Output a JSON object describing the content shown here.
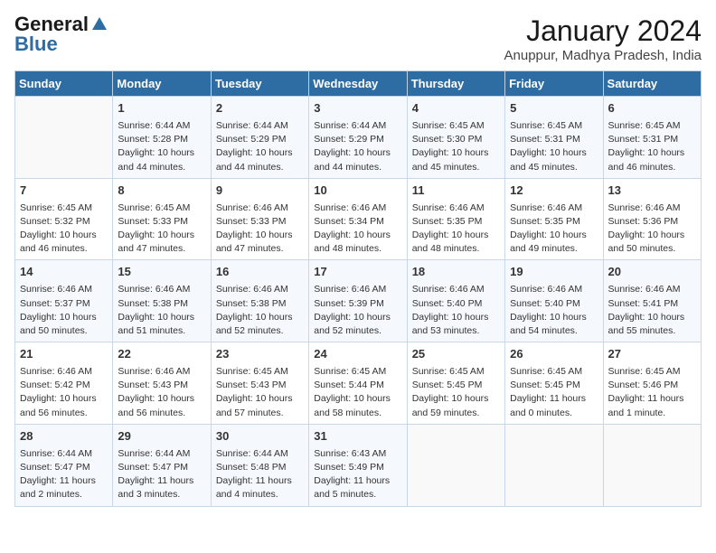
{
  "header": {
    "logo_general": "General",
    "logo_blue": "Blue",
    "month": "January 2024",
    "location": "Anuppur, Madhya Pradesh, India"
  },
  "days_of_week": [
    "Sunday",
    "Monday",
    "Tuesday",
    "Wednesday",
    "Thursday",
    "Friday",
    "Saturday"
  ],
  "weeks": [
    [
      {
        "day": "",
        "info": ""
      },
      {
        "day": "1",
        "info": "Sunrise: 6:44 AM\nSunset: 5:28 PM\nDaylight: 10 hours\nand 44 minutes."
      },
      {
        "day": "2",
        "info": "Sunrise: 6:44 AM\nSunset: 5:29 PM\nDaylight: 10 hours\nand 44 minutes."
      },
      {
        "day": "3",
        "info": "Sunrise: 6:44 AM\nSunset: 5:29 PM\nDaylight: 10 hours\nand 44 minutes."
      },
      {
        "day": "4",
        "info": "Sunrise: 6:45 AM\nSunset: 5:30 PM\nDaylight: 10 hours\nand 45 minutes."
      },
      {
        "day": "5",
        "info": "Sunrise: 6:45 AM\nSunset: 5:31 PM\nDaylight: 10 hours\nand 45 minutes."
      },
      {
        "day": "6",
        "info": "Sunrise: 6:45 AM\nSunset: 5:31 PM\nDaylight: 10 hours\nand 46 minutes."
      }
    ],
    [
      {
        "day": "7",
        "info": "Sunrise: 6:45 AM\nSunset: 5:32 PM\nDaylight: 10 hours\nand 46 minutes."
      },
      {
        "day": "8",
        "info": "Sunrise: 6:45 AM\nSunset: 5:33 PM\nDaylight: 10 hours\nand 47 minutes."
      },
      {
        "day": "9",
        "info": "Sunrise: 6:46 AM\nSunset: 5:33 PM\nDaylight: 10 hours\nand 47 minutes."
      },
      {
        "day": "10",
        "info": "Sunrise: 6:46 AM\nSunset: 5:34 PM\nDaylight: 10 hours\nand 48 minutes."
      },
      {
        "day": "11",
        "info": "Sunrise: 6:46 AM\nSunset: 5:35 PM\nDaylight: 10 hours\nand 48 minutes."
      },
      {
        "day": "12",
        "info": "Sunrise: 6:46 AM\nSunset: 5:35 PM\nDaylight: 10 hours\nand 49 minutes."
      },
      {
        "day": "13",
        "info": "Sunrise: 6:46 AM\nSunset: 5:36 PM\nDaylight: 10 hours\nand 50 minutes."
      }
    ],
    [
      {
        "day": "14",
        "info": "Sunrise: 6:46 AM\nSunset: 5:37 PM\nDaylight: 10 hours\nand 50 minutes."
      },
      {
        "day": "15",
        "info": "Sunrise: 6:46 AM\nSunset: 5:38 PM\nDaylight: 10 hours\nand 51 minutes."
      },
      {
        "day": "16",
        "info": "Sunrise: 6:46 AM\nSunset: 5:38 PM\nDaylight: 10 hours\nand 52 minutes."
      },
      {
        "day": "17",
        "info": "Sunrise: 6:46 AM\nSunset: 5:39 PM\nDaylight: 10 hours\nand 52 minutes."
      },
      {
        "day": "18",
        "info": "Sunrise: 6:46 AM\nSunset: 5:40 PM\nDaylight: 10 hours\nand 53 minutes."
      },
      {
        "day": "19",
        "info": "Sunrise: 6:46 AM\nSunset: 5:40 PM\nDaylight: 10 hours\nand 54 minutes."
      },
      {
        "day": "20",
        "info": "Sunrise: 6:46 AM\nSunset: 5:41 PM\nDaylight: 10 hours\nand 55 minutes."
      }
    ],
    [
      {
        "day": "21",
        "info": "Sunrise: 6:46 AM\nSunset: 5:42 PM\nDaylight: 10 hours\nand 56 minutes."
      },
      {
        "day": "22",
        "info": "Sunrise: 6:46 AM\nSunset: 5:43 PM\nDaylight: 10 hours\nand 56 minutes."
      },
      {
        "day": "23",
        "info": "Sunrise: 6:45 AM\nSunset: 5:43 PM\nDaylight: 10 hours\nand 57 minutes."
      },
      {
        "day": "24",
        "info": "Sunrise: 6:45 AM\nSunset: 5:44 PM\nDaylight: 10 hours\nand 58 minutes."
      },
      {
        "day": "25",
        "info": "Sunrise: 6:45 AM\nSunset: 5:45 PM\nDaylight: 10 hours\nand 59 minutes."
      },
      {
        "day": "26",
        "info": "Sunrise: 6:45 AM\nSunset: 5:45 PM\nDaylight: 11 hours\nand 0 minutes."
      },
      {
        "day": "27",
        "info": "Sunrise: 6:45 AM\nSunset: 5:46 PM\nDaylight: 11 hours\nand 1 minute."
      }
    ],
    [
      {
        "day": "28",
        "info": "Sunrise: 6:44 AM\nSunset: 5:47 PM\nDaylight: 11 hours\nand 2 minutes."
      },
      {
        "day": "29",
        "info": "Sunrise: 6:44 AM\nSunset: 5:47 PM\nDaylight: 11 hours\nand 3 minutes."
      },
      {
        "day": "30",
        "info": "Sunrise: 6:44 AM\nSunset: 5:48 PM\nDaylight: 11 hours\nand 4 minutes."
      },
      {
        "day": "31",
        "info": "Sunrise: 6:43 AM\nSunset: 5:49 PM\nDaylight: 11 hours\nand 5 minutes."
      },
      {
        "day": "",
        "info": ""
      },
      {
        "day": "",
        "info": ""
      },
      {
        "day": "",
        "info": ""
      }
    ]
  ]
}
